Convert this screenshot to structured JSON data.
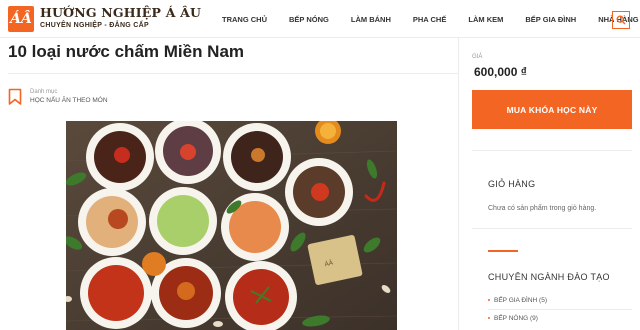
{
  "header": {
    "brand_title": "HƯỚNG NGHIỆP Á ÂU",
    "brand_tagline": "CHUYÊN NGHIỆP - ĐẲNG CẤP",
    "nav": [
      "TRANG CHỦ",
      "BẾP NÓNG",
      "LÀM BÁNH",
      "PHA CHẾ",
      "LÀM KEM",
      "BẾP GIA ĐÌNH",
      "NHÀ HÀNG KS"
    ],
    "search_icon": "search-icon",
    "accent_color": "#f26522"
  },
  "main": {
    "title": "10 loại nước chấm Miền Nam",
    "category_label": "Danh mục",
    "category_value": "HỌC NẤU ĂN THEO MÓN",
    "hero_alt": "food-photo"
  },
  "sidebar": {
    "price_label": "GIÁ",
    "price_value": "600,000 ₫",
    "buy_button": "MUA KHÓA HỌC NÀY",
    "cart_title": "GIỎ HÀNG",
    "cart_empty": "Chưa có sản phẩm trong giỏ hàng.",
    "majors_title": "CHUYÊN NGÀNH ĐÀO TẠO",
    "majors": [
      {
        "label": "BẾP GIA ĐÌNH (5)"
      },
      {
        "label": "BẾP NÓNG (9)"
      }
    ]
  }
}
